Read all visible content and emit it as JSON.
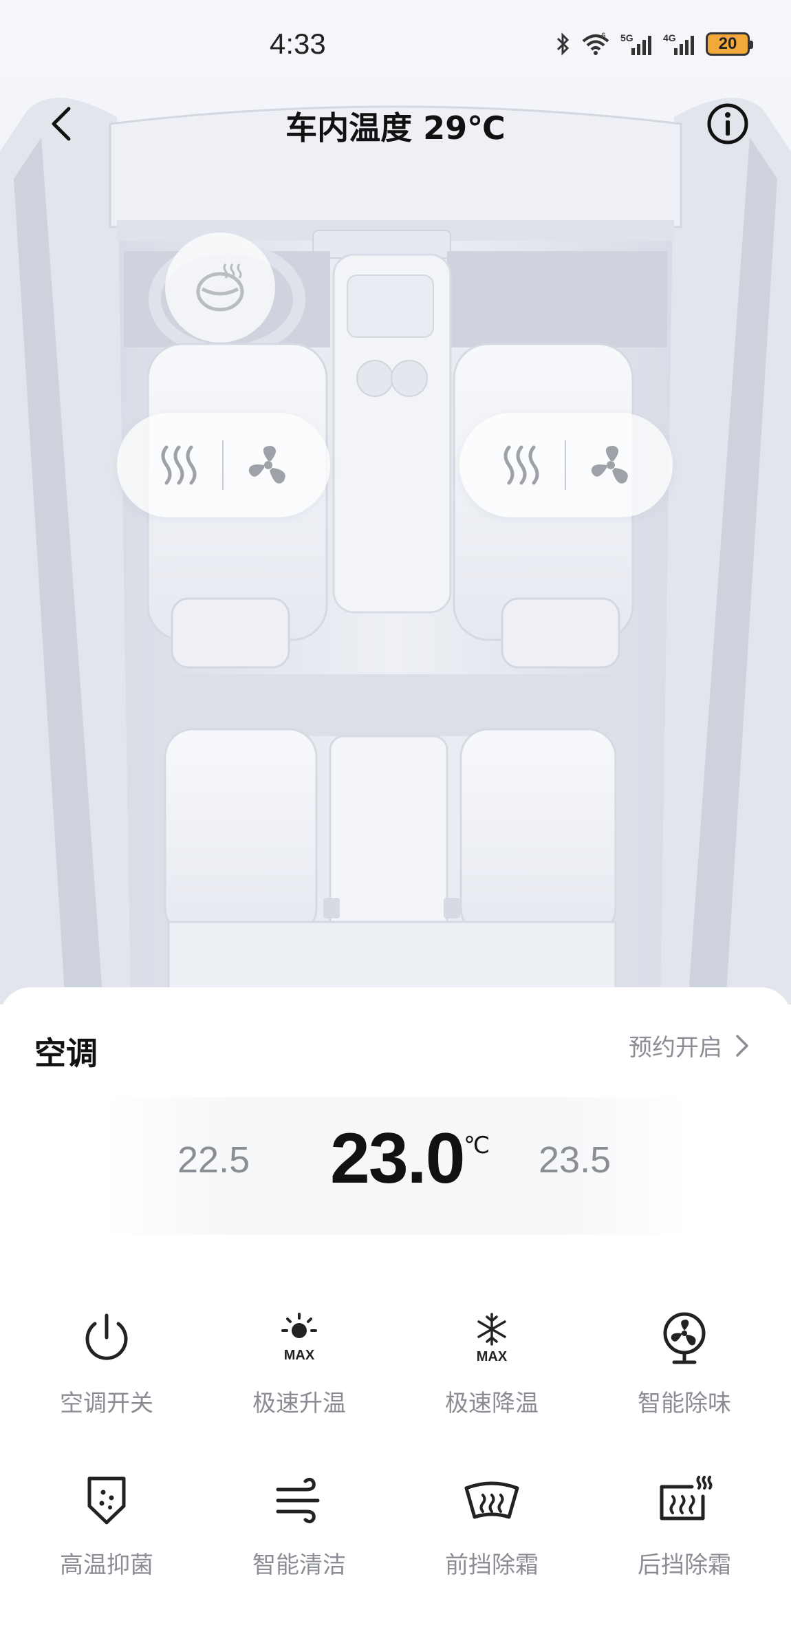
{
  "status_bar": {
    "time": "4:33",
    "battery": "20",
    "signal_1": "5G",
    "signal_2": "4G",
    "wifi_label": "6"
  },
  "header": {
    "title": "车内温度 29℃"
  },
  "seat_controls": {
    "steering_heat_icon": "steering-wheel-heat-icon",
    "left_seat": {
      "heat_icon": "seat-heat-icon",
      "vent_icon": "seat-vent-fan-icon"
    },
    "right_seat": {
      "heat_icon": "seat-heat-icon",
      "vent_icon": "seat-vent-fan-icon"
    }
  },
  "ac": {
    "section_title": "空调",
    "schedule_label": "预约开启",
    "temp_prev": "22.5",
    "temp_current": "23.0",
    "temp_unit": "℃",
    "temp_next": "23.5"
  },
  "controls": [
    {
      "label": "空调开关",
      "icon": "power-icon"
    },
    {
      "label": "极速升温",
      "icon": "max-heat-sun-icon"
    },
    {
      "label": "极速降温",
      "icon": "max-cool-snowflake-icon"
    },
    {
      "label": "智能除味",
      "icon": "fan-purifier-icon"
    },
    {
      "label": "高温抑菌",
      "icon": "shield-sterilize-icon"
    },
    {
      "label": "智能清洁",
      "icon": "wind-clean-icon"
    },
    {
      "label": "前挡除霜",
      "icon": "front-defrost-icon"
    },
    {
      "label": "后挡除霜",
      "icon": "rear-defrost-icon"
    }
  ],
  "colors": {
    "accent_text": "#111111",
    "muted_text": "#8a8d94",
    "battery_fill": "#f3a93a"
  }
}
